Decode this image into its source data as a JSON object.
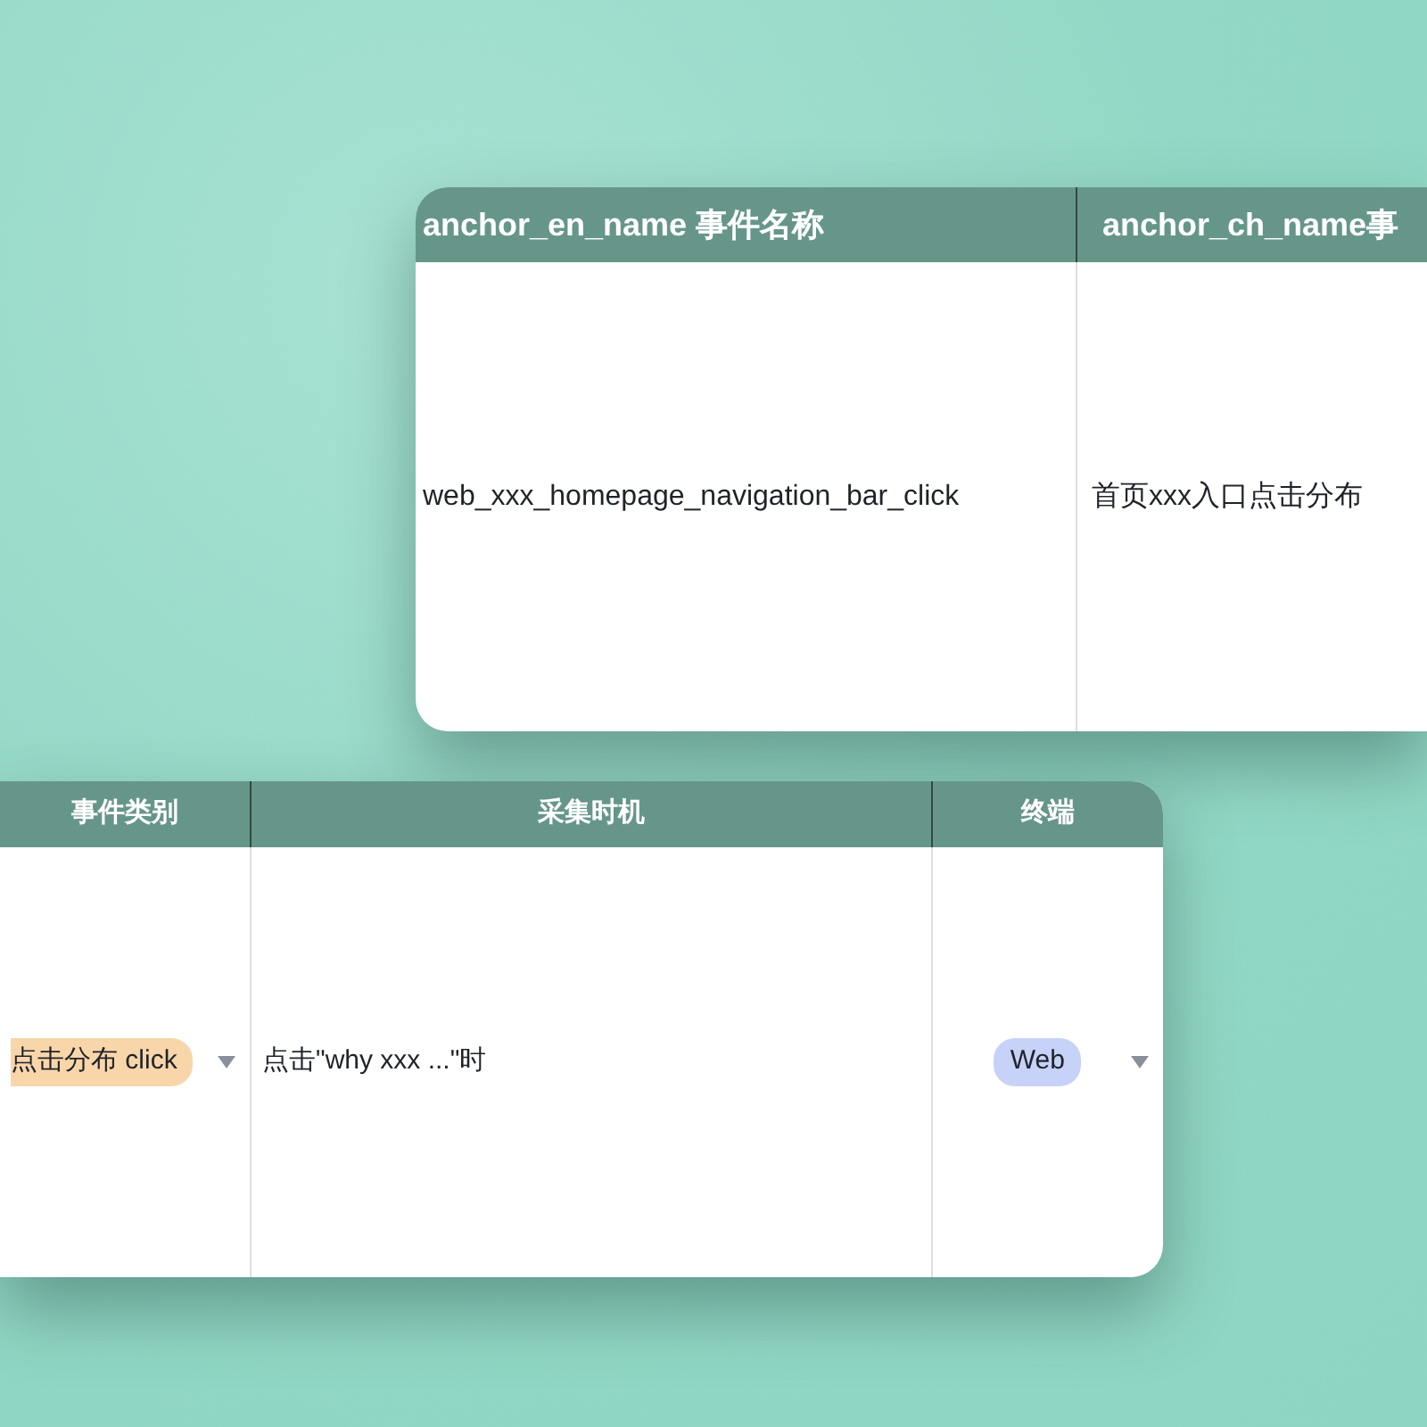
{
  "tables": [
    {
      "columns": [
        "anchor_en_name 事件名称",
        "anchor_ch_name事"
      ],
      "rows": [
        [
          {
            "kind": "text",
            "text": "web_xxx_homepage_navigation_bar_click"
          },
          {
            "kind": "text",
            "text": "首页xxx入口点击分布"
          }
        ]
      ]
    },
    {
      "columns": [
        "事件类别",
        "采集时机",
        "终端"
      ],
      "rows": [
        [
          {
            "kind": "tag",
            "text": "点击分布 click",
            "color": "#f8d6aa"
          },
          {
            "kind": "text",
            "text": "点击\"why xxx ...\"时"
          },
          {
            "kind": "tag",
            "text": "Web",
            "color": "#c6d2f8"
          }
        ]
      ]
    }
  ]
}
